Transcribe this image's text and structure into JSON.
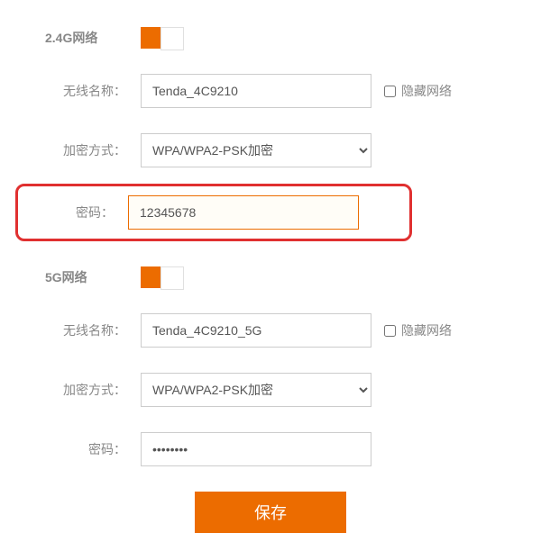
{
  "wifi24": {
    "title": "2.4G网络",
    "toggle_on": true,
    "ssid_label": "无线名称：",
    "ssid_value": "Tenda_4C9210",
    "hide_label": "隐藏网络",
    "hide_checked": false,
    "enc_label": "加密方式：",
    "enc_value": "WPA/WPA2-PSK加密",
    "pwd_label": "密码：",
    "pwd_value": "12345678"
  },
  "wifi5": {
    "title": "5G网络",
    "toggle_on": true,
    "ssid_label": "无线名称：",
    "ssid_value": "Tenda_4C9210_5G",
    "hide_label": "隐藏网络",
    "hide_checked": false,
    "enc_label": "加密方式：",
    "enc_value": "WPA/WPA2-PSK加密",
    "pwd_label": "密码：",
    "pwd_value": "••••••••"
  },
  "actions": {
    "save_label": "保存"
  }
}
